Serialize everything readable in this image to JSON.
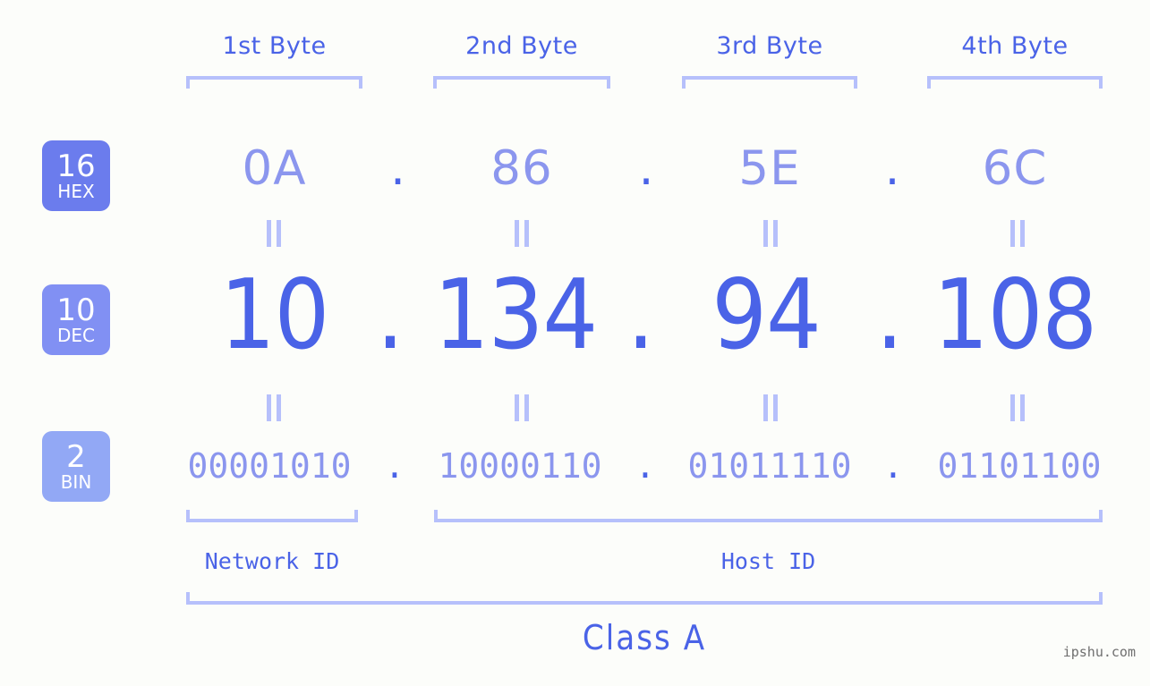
{
  "background_color": "#fcfdfa",
  "accent_color": "#4a63e7",
  "accent_light_color": "#8b96ee",
  "bracket_color": "#b6c0fb",
  "header": {
    "byte_labels": [
      {
        "text": "1st Byte"
      },
      {
        "text": "2nd Byte"
      },
      {
        "text": "3rd Byte"
      },
      {
        "text": "4th Byte"
      }
    ]
  },
  "badges": [
    {
      "num": "16",
      "abbr": "HEX",
      "color": "#6b7ced"
    },
    {
      "num": "10",
      "abbr": "DEC",
      "color": "#8190f3"
    },
    {
      "num": "2",
      "abbr": "BIN",
      "color": "#92a8f5"
    }
  ],
  "separator": ".",
  "equals_glyph": "=",
  "rows": {
    "hex": {
      "label": "HEX",
      "base": "16",
      "values": [
        "0A",
        "86",
        "5E",
        "6C"
      ]
    },
    "dec": {
      "label": "DEC",
      "base": "10",
      "values": [
        "10",
        "134",
        "94",
        "108"
      ]
    },
    "bin": {
      "label": "BIN",
      "base": "2",
      "values": [
        "00001010",
        "10000110",
        "01011110",
        "01101100"
      ]
    }
  },
  "footer": {
    "network_id_label": "Network ID",
    "host_id_label": "Host ID",
    "class_label": "Class A",
    "watermark": "ipshu.com"
  }
}
